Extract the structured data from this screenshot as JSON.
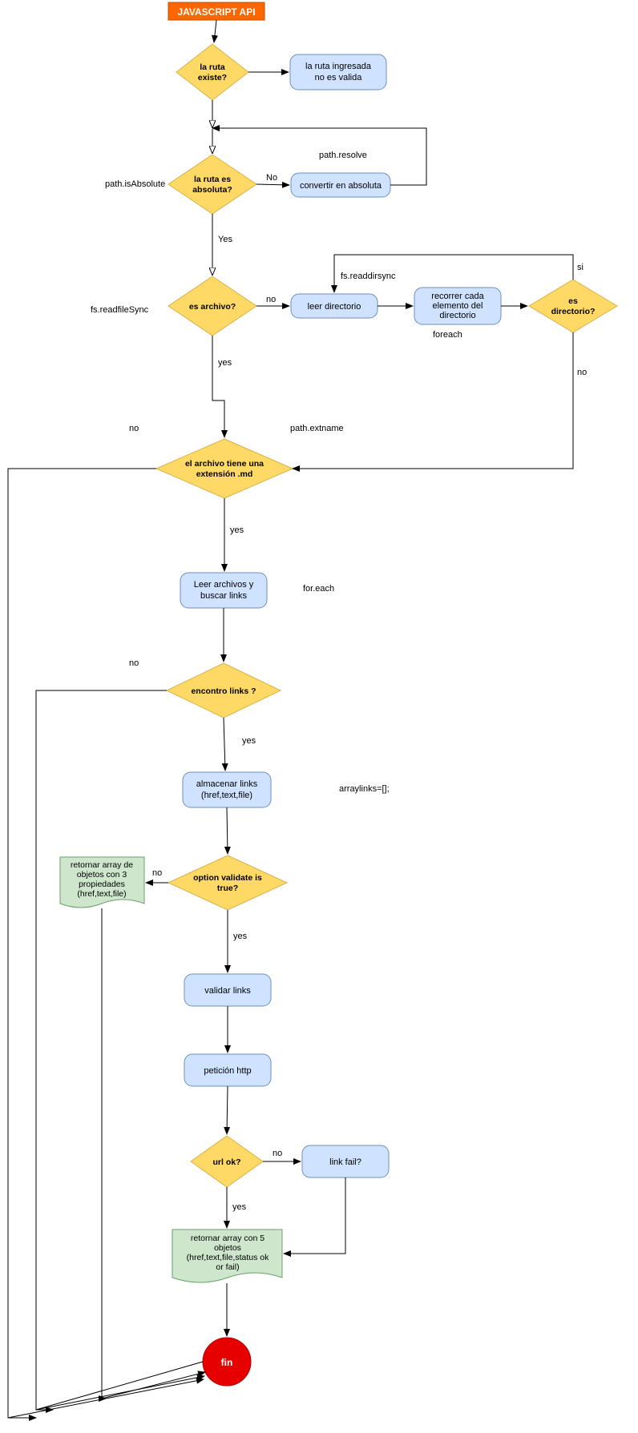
{
  "title": "JAVASCRIPT API",
  "nodes": {
    "start": "JAVASCRIPT API",
    "d_path_exists": [
      "la ruta",
      "existe?"
    ],
    "p_invalid_path": [
      "la ruta ingresada",
      "no es valida"
    ],
    "d_is_absolute": [
      "la ruta es",
      "absoluta?"
    ],
    "p_to_absolute": "convertir en absoluta",
    "d_is_file": "es archivo?",
    "p_read_dir": "leer directorio",
    "p_iterate_dir": [
      "recorrer cada",
      "elemento del",
      "directorio"
    ],
    "d_is_dir": [
      "es",
      "directorio?"
    ],
    "d_is_md": [
      "el archivo tiene una",
      "extensión .md"
    ],
    "p_read_links": [
      "Leer archivos y",
      "buscar links"
    ],
    "d_found_links": "encontro links ?",
    "p_store_links": [
      "almacenar links",
      "(href,text,file)"
    ],
    "d_validate": [
      "option validate is",
      "true?"
    ],
    "doc_three": [
      "retornar array de",
      "objetos con  3",
      "propiedades",
      "(href,text,file)"
    ],
    "p_validate": "validar links",
    "p_http": "petición http",
    "d_url_ok": "url ok?",
    "p_link_fail": "link fail?",
    "doc_five": [
      "retornar array con 5",
      "objetos",
      "(href,text,file,status ok",
      "or fail)"
    ],
    "end": "fin"
  },
  "labels": {
    "path_isabsolute": "path.isAbsolute",
    "path_resolve": "path.resolve",
    "no": "No",
    "yes_cap": "Yes",
    "no_lc": "no",
    "yes_lc": "yes",
    "si": "si",
    "fs_readfile": "fs.readfileSync",
    "fs_readdir": "fs.readdirsync",
    "foreach": "foreach",
    "path_extname": "path.extname",
    "for_each": "for.each",
    "arraylinks": "arraylinks=[];"
  }
}
